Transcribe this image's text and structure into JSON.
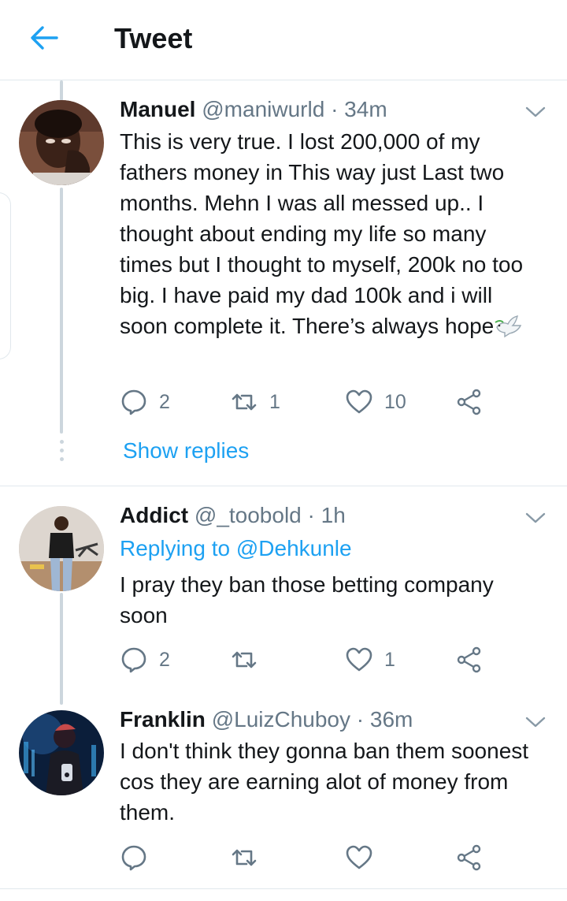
{
  "header": {
    "title": "Tweet",
    "back_icon": "arrow-left-icon",
    "accent": "#1da1f2"
  },
  "colors": {
    "text": "#14171a",
    "secondary": "#657786",
    "link": "#1da1f2",
    "divider": "#e1e8ed"
  },
  "tweets": [
    {
      "name": "Manuel",
      "handle": "@maniwurld",
      "sep": "·",
      "time": "34m",
      "text": "This is very true. I lost 200,000 of my fathers money in This way just Last two months. Mehn I was all messed up.. I thought about ending my life so many times but I thought to myself, 200k no too big. I have paid my dad 100k and i will soon complete it. There’s always hope",
      "emoji": "dove-of-peace-icon",
      "replies": "2",
      "retweets": "1",
      "likes": "10",
      "show_replies": "Show replies"
    },
    {
      "name": "Addict",
      "handle": "@_toobold",
      "sep": "·",
      "time": "1h",
      "replying_prefix": "Replying to",
      "replying_to": "@Dehkunle",
      "text": "I pray they ban those betting company soon",
      "replies": "2",
      "retweets": "",
      "likes": "1"
    },
    {
      "name": "Franklin",
      "handle": "@LuizChuboy",
      "sep": "·",
      "time": "36m",
      "text": "I don't think they gonna ban them soonest cos they are earning alot of money from them.",
      "replies": "",
      "retweets": "",
      "likes": ""
    }
  ]
}
